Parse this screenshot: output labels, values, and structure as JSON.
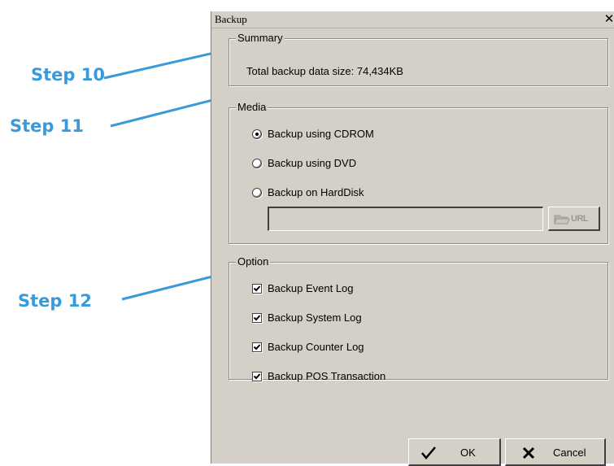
{
  "annotations": {
    "step10": "Step 10",
    "step11": "Step 11",
    "step12": "Step 12"
  },
  "dialog": {
    "title": "Backup",
    "close_glyph": "✕",
    "summary": {
      "legend": "Summary",
      "text": "Total backup data size: 74,434KB"
    },
    "media": {
      "legend": "Media",
      "options": [
        {
          "label": "Backup using CDROM",
          "selected": true
        },
        {
          "label": "Backup using DVD",
          "selected": false
        },
        {
          "label": "Backup on HardDisk",
          "selected": false
        }
      ],
      "path_value": "",
      "url_button_label": "URL",
      "url_button_icon": "folder-url-icon"
    },
    "option": {
      "legend": "Option",
      "items": [
        {
          "label": "Backup Event Log",
          "checked": true
        },
        {
          "label": "Backup System Log",
          "checked": true
        },
        {
          "label": "Backup Counter Log",
          "checked": true
        },
        {
          "label": "Backup POS Transaction",
          "checked": true
        }
      ]
    },
    "buttons": {
      "ok": "OK",
      "ok_icon": "checkmark-icon",
      "cancel": "Cancel",
      "cancel_icon": "x-mark-icon"
    }
  },
  "colors": {
    "annotation": "#3a9ad9",
    "dialog_bg": "#d4d0c8"
  }
}
